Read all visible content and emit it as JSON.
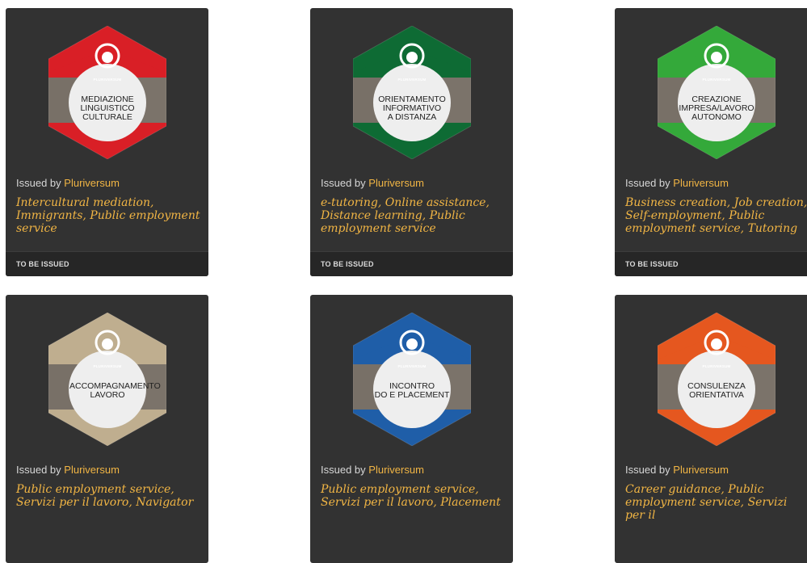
{
  "cards": [
    {
      "badge_color": "#d91f26",
      "badge_lines": "MEDIAZIONE\nLINGUISTICO\nCULTURALE",
      "logo": "PLURIVERSUM",
      "issued_prefix": "Issued by",
      "issuer": "Pluriversum",
      "tags": "Intercultural mediation, Immigrants, Public employment service",
      "status": "TO BE ISSUED",
      "icon": "pluriversum-logo-icon"
    },
    {
      "badge_color": "#0e6b34",
      "badge_lines": "ORIENTAMENTO\nINFORMATIVO\nA DISTANZA",
      "logo": "PLURIVERSUM",
      "issued_prefix": "Issued by",
      "issuer": "Pluriversum",
      "tags": "e-tutoring, Online assistance, Distance learning, Public employment service",
      "status": "TO BE ISSUED",
      "icon": "pluriversum-logo-icon"
    },
    {
      "badge_color": "#34a93a",
      "badge_lines": "CREAZIONE\nIMPRESA/LAVORO\nAUTONOMO",
      "logo": "PLURIVERSUM",
      "issued_prefix": "Issued by",
      "issuer": "Pluriversum",
      "tags": "Business creation, Job creation, Self-employment, Public employment service, Tutoring",
      "status": "TO BE ISSUED",
      "icon": "pluriversum-logo-icon"
    },
    {
      "badge_color": "#bfae8f",
      "badge_lines": "ACCOMPAGNAMENTO\nLAVORO",
      "logo": "PLURIVERSUM",
      "issued_prefix": "Issued by",
      "issuer": "Pluriversum",
      "tags": "Public employment service, Servizi per il lavoro, Navigator",
      "status": "",
      "icon": "pluriversum-logo-icon"
    },
    {
      "badge_color": "#1f5ea8",
      "badge_lines": "INCONTRO\nDO E PLACEMENT",
      "logo": "PLURIVERSUM",
      "issued_prefix": "Issued by",
      "issuer": "Pluriversum",
      "tags": "Public employment service, Servizi per il lavoro, Placement",
      "status": "",
      "icon": "pluriversum-logo-icon"
    },
    {
      "badge_color": "#e5571f",
      "badge_lines": "CONSULENZA\nORIENTATIVA",
      "logo": "PLURIVERSUM",
      "issued_prefix": "Issued by",
      "issuer": "Pluriversum",
      "tags": "Career guidance, Public employment service, Servizi per il",
      "status": "",
      "icon": "pluriversum-logo-icon"
    }
  ]
}
